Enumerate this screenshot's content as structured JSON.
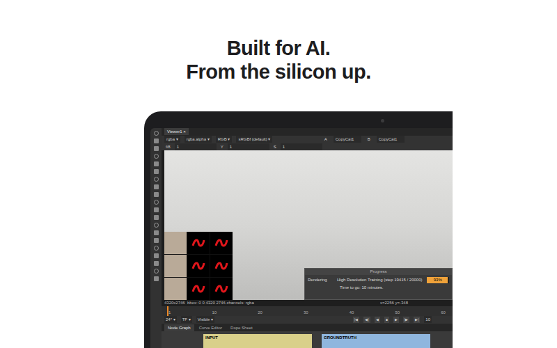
{
  "headline": [
    "Built for AI.",
    "From the silicon up."
  ],
  "viewer_tabs": [
    {
      "label": "Viewer1",
      "selected": true
    }
  ],
  "toolbar": {
    "channels": [
      "rgba",
      "rgba.alpha",
      "RGB",
      "sRGBf (default)"
    ],
    "inputs": [
      "A",
      "CopyCat1",
      "B",
      "CopyCat1"
    ]
  },
  "toolbar2": [
    "f/8",
    "1",
    "Y",
    "1",
    "S",
    "1"
  ],
  "progress": {
    "title": "Progress",
    "label": "Rendering",
    "task": "High Resolution Training (step 19415 / 20000)",
    "time": "Time to go: 10 minutes.",
    "level": 0.93,
    "reading": "93%"
  },
  "status": {
    "info": "4320x2746  bbox: 0 0 4320 2746 channels: rgba",
    "coords": "x=2256 y=-348"
  },
  "timeline": {
    "ticks": [
      "1",
      "10",
      "20",
      "30",
      "40",
      "50",
      "60"
    ],
    "playhead": 0.02
  },
  "controls": {
    "fps": "24*",
    "mode": "TF",
    "visibility": "Visible",
    "transport": [
      "|◀",
      "◀|",
      "◀",
      "■",
      "▶",
      "|▶",
      "▶|"
    ],
    "step": "10"
  },
  "panel_tabs": [
    {
      "label": "Node Graph",
      "selected": true
    },
    {
      "label": "Curve Editor",
      "selected": false
    },
    {
      "label": "Dope Sheet",
      "selected": false
    }
  ],
  "nodes": [
    {
      "label": "INPUT",
      "color": "#d9d08a"
    },
    {
      "label": "GROUNDTRUTH",
      "color": "#8fb6de"
    }
  ]
}
